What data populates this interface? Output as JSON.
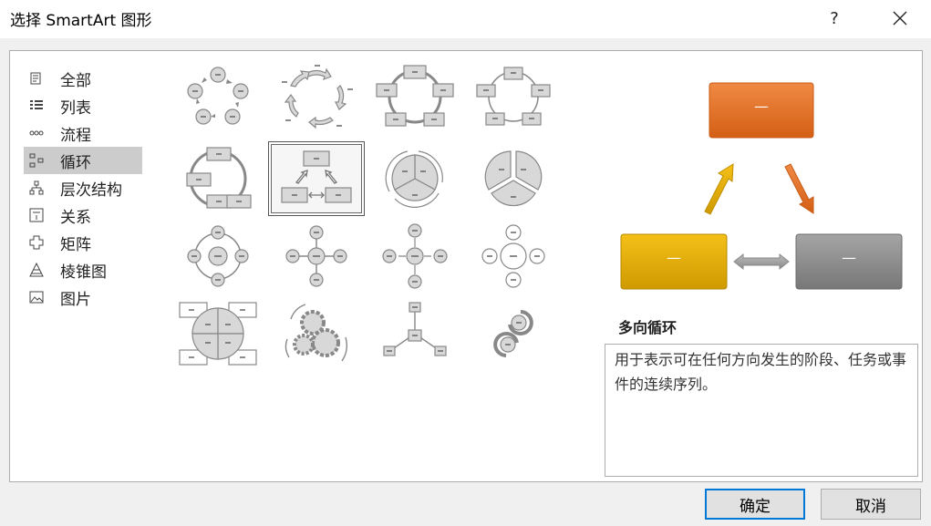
{
  "dialog": {
    "title": "选择 SmartArt 图形",
    "help": "?",
    "close": "✕"
  },
  "categories": [
    {
      "label": "全部",
      "icon": "all-icon"
    },
    {
      "label": "列表",
      "icon": "list-icon"
    },
    {
      "label": "流程",
      "icon": "process-icon"
    },
    {
      "label": "循环",
      "icon": "cycle-icon",
      "selected": true
    },
    {
      "label": "层次结构",
      "icon": "hierarchy-icon"
    },
    {
      "label": "关系",
      "icon": "relationship-icon"
    },
    {
      "label": "矩阵",
      "icon": "matrix-icon"
    },
    {
      "label": "棱锥图",
      "icon": "pyramid-icon"
    },
    {
      "label": "图片",
      "icon": "picture-icon"
    }
  ],
  "preview": {
    "name": "多向循环",
    "description": "用于表示可在任何方向发生的阶段、任务或事件的连续序列。",
    "box_text": "—",
    "colors": {
      "top": "#e06f25",
      "left": "#e3a800",
      "right": "#8a8a8a"
    }
  },
  "buttons": {
    "ok": "确定",
    "cancel": "取消"
  }
}
